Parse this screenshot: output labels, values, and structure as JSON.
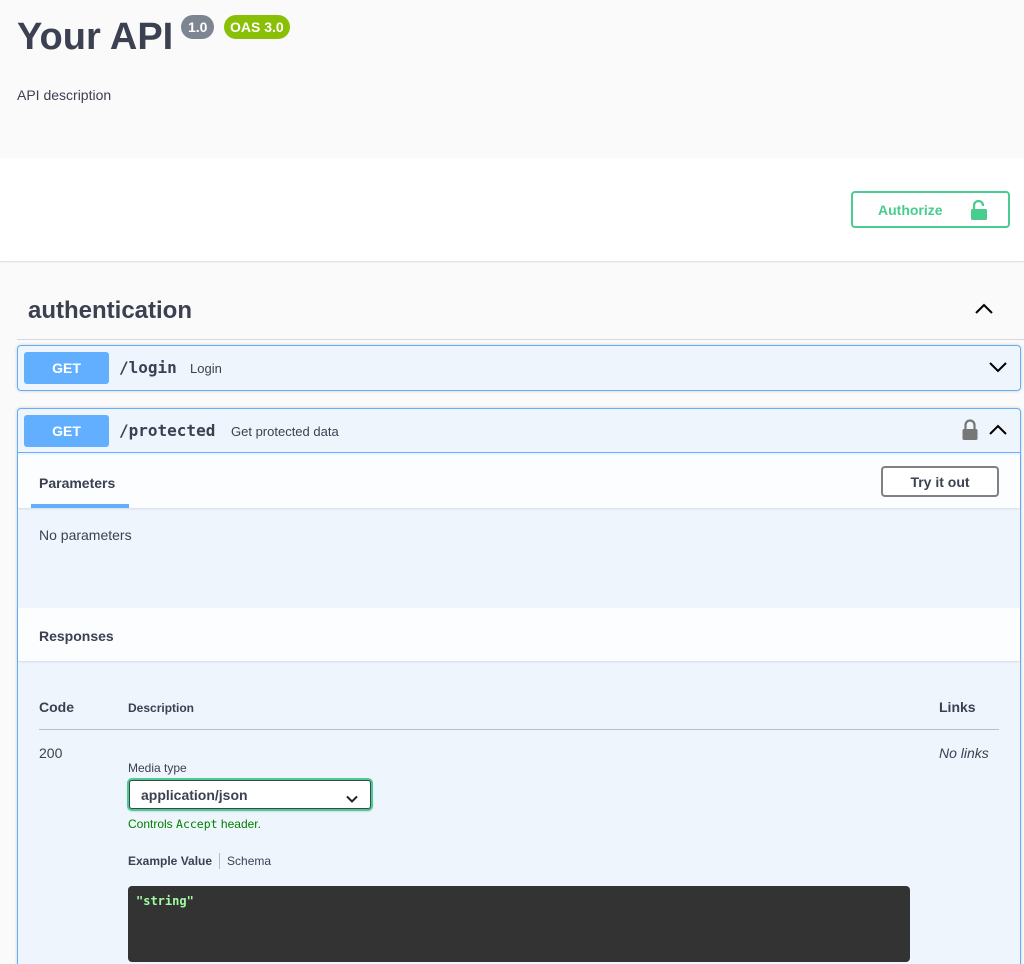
{
  "info": {
    "title": "Your API",
    "version": "1.0",
    "oas": "OAS 3.0",
    "description": "API description"
  },
  "auth": {
    "authorize_label": "Authorize"
  },
  "tag": {
    "name": "authentication",
    "expanded": true
  },
  "operations": [
    {
      "method": "GET",
      "path": "/login",
      "summary": "Login",
      "expanded": false,
      "locked": false
    },
    {
      "method": "GET",
      "path": "/protected",
      "summary": "Get protected data",
      "expanded": true,
      "locked": true,
      "parameters_tab": "Parameters",
      "try_it_out": "Try it out",
      "no_parameters": "No parameters",
      "responses_title": "Responses",
      "columns": {
        "code": "Code",
        "description": "Description",
        "links": "Links"
      },
      "responses": [
        {
          "code": "200",
          "links": "No links",
          "media_type_label": "Media type",
          "media_type": "application/json",
          "controls_prefix": "Controls",
          "controls_code": "Accept",
          "controls_suffix": "header.",
          "example_tab": "Example Value",
          "schema_tab": "Schema",
          "example": "\"string\""
        }
      ]
    }
  ],
  "colors": {
    "get": "#61affe",
    "authorize": "#49cc90",
    "oas_badge": "#89bf04",
    "version_badge": "#7d8492",
    "code_bg": "#333333",
    "code_text": "#a2fca2"
  },
  "icons": {
    "authorize": "lock-open-icon",
    "operation_lock": "lock-icon",
    "collapse": "chevron-up-icon",
    "expand": "chevron-down-icon"
  }
}
